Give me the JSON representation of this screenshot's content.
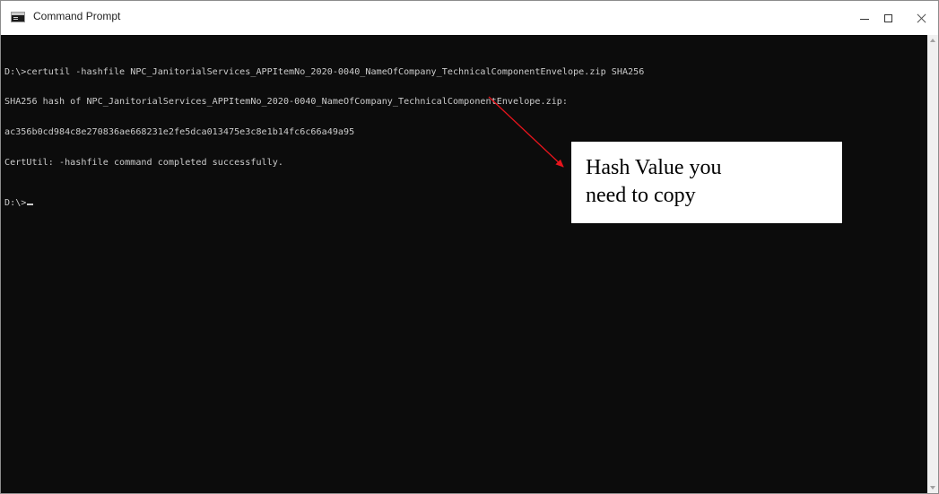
{
  "window": {
    "title": "Command Prompt",
    "icon": "cmd-icon",
    "controls": [
      "minimize-icon",
      "maximize-icon",
      "close-icon"
    ]
  },
  "console": {
    "lines": [
      "D:\\>certutil -hashfile NPC_JanitorialServices_APPItemNo_2020-0040_NameOfCompany_TechnicalComponentEnvelope.zip SHA256",
      "SHA256 hash of NPC_JanitorialServices_APPItemNo_2020-0040_NameOfCompany_TechnicalComponentEnvelope.zip:",
      "ac356b0cd984c8e270836ae668231e2fe5dca013475e3c8e1b14fc6c66a49a95",
      "CertUtil: -hashfile command completed successfully."
    ],
    "prompt": "D:\\>"
  },
  "annotation": {
    "line1": "Hash Value you",
    "line2": "need to copy",
    "color": "#e8141c"
  },
  "colors": {
    "console_bg": "#0c0c0c",
    "console_text": "#cccccc",
    "titlebar_bg": "#ffffff"
  }
}
